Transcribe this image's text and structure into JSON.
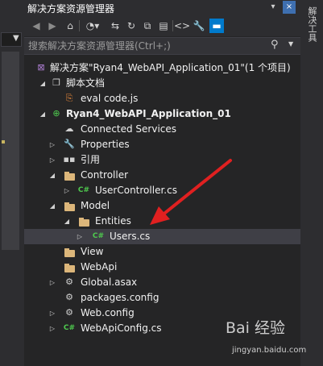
{
  "panel": {
    "title": "解决方案资源管理器",
    "pin_icon": "pin-icon",
    "close_icon": "close-icon"
  },
  "right_strip": {
    "label": "解决工具"
  },
  "toolbar": {
    "buttons": [
      "back-icon",
      "forward-icon",
      "home-icon",
      "sync-icon",
      "pending-changes-icon",
      "refresh-icon",
      "collapse-all-icon",
      "show-all-files-icon",
      "view-code-icon",
      "properties-icon",
      "preview-icon"
    ]
  },
  "search": {
    "placeholder": "搜索解决方案资源管理器(Ctrl+;)"
  },
  "tree": {
    "solution": "解决方案\"Ryan4_WebAPI_Application_01\"(1 个项目)",
    "script_docs": "脚本文档",
    "eval_file": "eval code.js",
    "project": "Ryan4_WebAPI_Application_01",
    "connected_services": "Connected Services",
    "properties": "Properties",
    "references": "引用",
    "controller": "Controller",
    "user_controller": "UserController.cs",
    "model": "Model",
    "entities": "Entities",
    "users": "Users.cs",
    "view": "View",
    "webapi": "WebApi",
    "global": "Global.asax",
    "packages": "packages.config",
    "webconfig": "Web.config",
    "webapiconfig": "WebApiConfig.cs"
  },
  "watermark": {
    "main": "Bai 经验",
    "sub": "jingyan.baidu.com"
  },
  "colors": {
    "accent": "#007acc",
    "folder": "#dcb67a",
    "annotation": "#e02020",
    "selection": "#3f3f46"
  }
}
